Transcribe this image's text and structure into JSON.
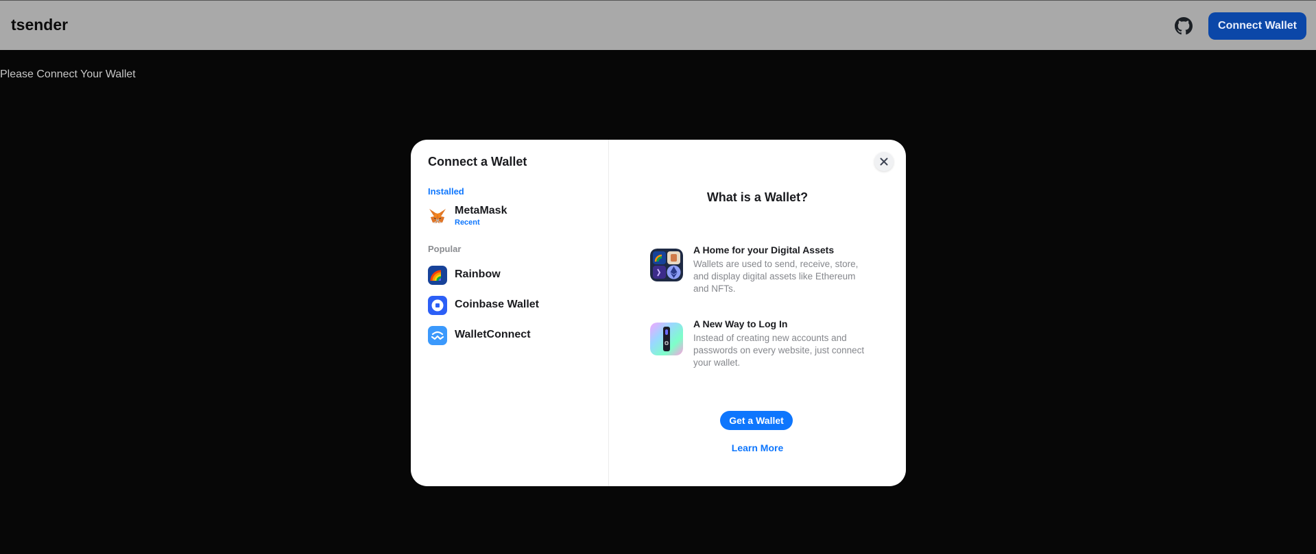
{
  "header": {
    "title": "tsender",
    "connect_label": "Connect Wallet",
    "background": "#a9a9a9",
    "connect_color": "#0b47a8"
  },
  "page": {
    "message": "Please Connect Your Wallet"
  },
  "modal": {
    "title": "Connect a Wallet",
    "groups": [
      {
        "label": "Installed",
        "wallets": [
          {
            "name": "MetaMask",
            "sub": "Recent",
            "icon": "metamask-icon"
          }
        ]
      },
      {
        "label": "Popular",
        "wallets": [
          {
            "name": "Rainbow",
            "icon": "rainbow-icon"
          },
          {
            "name": "Coinbase Wallet",
            "icon": "coinbase-icon"
          },
          {
            "name": "WalletConnect",
            "icon": "walletconnect-icon"
          }
        ]
      }
    ],
    "info": {
      "title": "What is a Wallet?",
      "items": [
        {
          "title": "A Home for your Digital Assets",
          "desc": "Wallets are used to send, receive, store, and display digital assets like Ethereum and NFTs.",
          "icon": "digital-assets-icon"
        },
        {
          "title": "A New Way to Log In",
          "desc": "Instead of creating new accounts and passwords on every website, just connect your wallet.",
          "icon": "login-key-icon"
        }
      ],
      "get_wallet": "Get a Wallet",
      "learn_more": "Learn More"
    },
    "accent": "#0e76fd"
  }
}
